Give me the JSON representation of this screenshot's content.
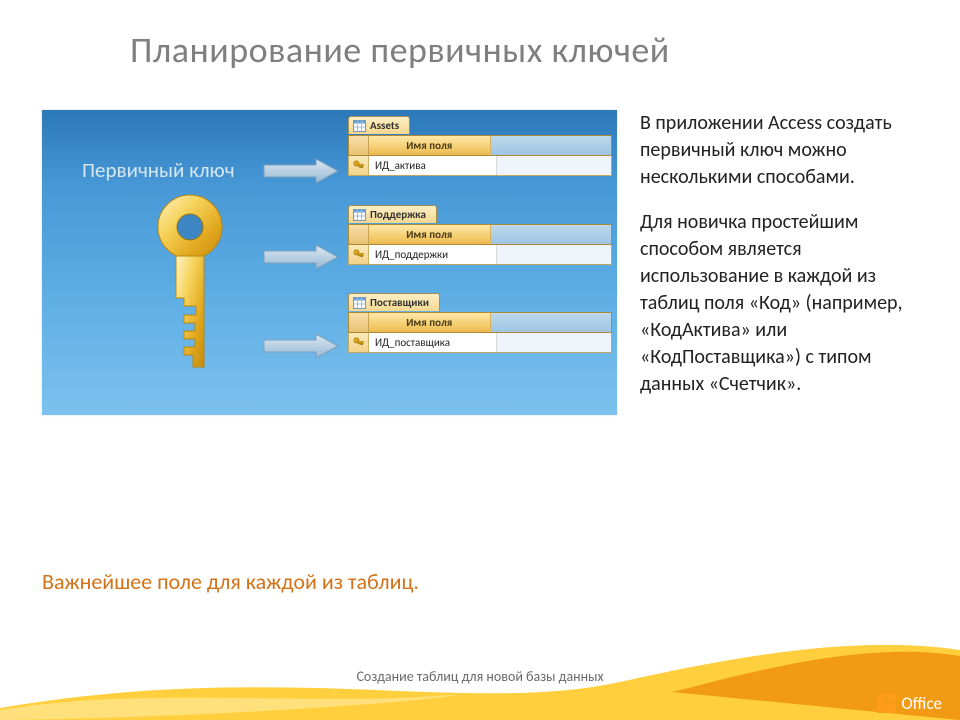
{
  "slide": {
    "title": "Планирование первичных ключей",
    "caption": "Важнейшее поле для каждой из таблиц.",
    "footer": "Создание таблиц для новой базы данных"
  },
  "illustration": {
    "primary_key_label": "Первичный ключ",
    "header_col_label": "Имя поля",
    "tables": [
      {
        "tab": "Assets",
        "pk_field": "ИД_актива"
      },
      {
        "tab": "Поддержка",
        "pk_field": "ИД_поддержки"
      },
      {
        "tab": "Поставщики",
        "pk_field": "ИД_поставщика"
      }
    ]
  },
  "body": {
    "p1": "В приложении Access создать первичный ключ можно несколькими способами.",
    "p2": "Для новичка простейшим способом является использование в каждой из таблиц поля «Код» (например, «КодАктива» или «КодПоставщика») с типом данных «Счетчик»."
  },
  "branding": {
    "product": "Office"
  }
}
